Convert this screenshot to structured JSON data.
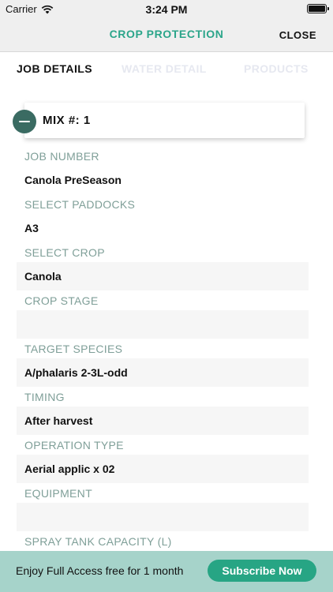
{
  "status_bar": {
    "carrier": "Carrier",
    "time": "3:24 PM"
  },
  "nav": {
    "title": "CROP PROTECTION",
    "close_label": "CLOSE"
  },
  "tabs": [
    {
      "label": "JOB DETAILS"
    },
    {
      "label": "WATER DETAIL"
    },
    {
      "label": "PRODUCTS"
    }
  ],
  "mix": {
    "label": "MIX #: 1"
  },
  "fields": [
    {
      "label": "JOB NUMBER",
      "value": "Canola PreSeason"
    },
    {
      "label": "SELECT PADDOCKS",
      "value": "A3"
    },
    {
      "label": "SELECT CROP",
      "value": "Canola"
    },
    {
      "label": "CROP STAGE",
      "value": ""
    },
    {
      "label": "TARGET SPECIES",
      "value": "A/phalaris 2-3L-odd"
    },
    {
      "label": "TIMING",
      "value": "After harvest"
    },
    {
      "label": "OPERATION TYPE",
      "value": "Aerial applic x 02"
    },
    {
      "label": "EQUIPMENT",
      "value": ""
    },
    {
      "label": "SPRAY TANK CAPACITY (L)",
      "value": ""
    }
  ],
  "promo": {
    "text": "Enjoy Full Access free for 1 month",
    "button": "Subscribe Now"
  },
  "colors": {
    "accent": "#2ba58a",
    "label": "#7f9f98",
    "promo_bg": "#a6d3ca"
  }
}
